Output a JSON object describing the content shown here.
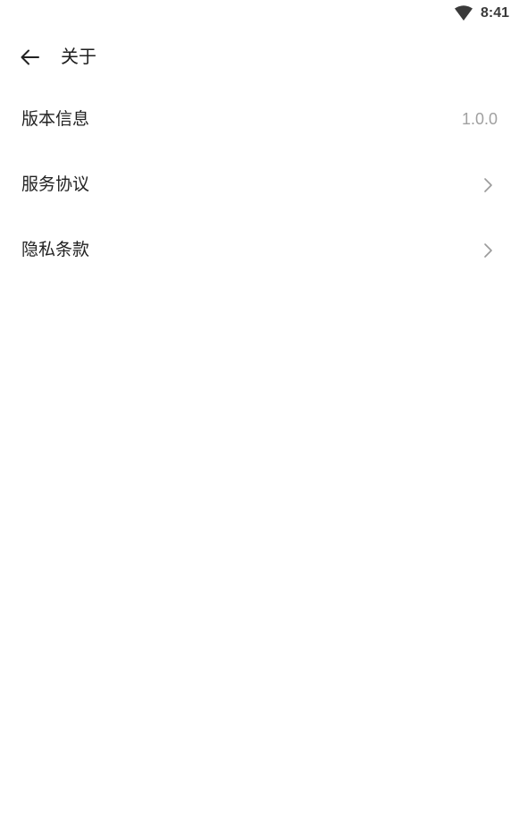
{
  "status_bar": {
    "time": "8:41",
    "wifi_icon": "wifi-icon"
  },
  "header": {
    "back_icon": "arrow-left-icon",
    "title": "关于"
  },
  "list": {
    "items": [
      {
        "label": "版本信息",
        "value": "1.0.0"
      },
      {
        "label": "服务协议",
        "icon": "chevron-right-icon"
      },
      {
        "label": "隐私条款",
        "icon": "chevron-right-icon"
      }
    ]
  },
  "colors": {
    "background": "#ffffff",
    "text_primary": "#222222",
    "text_secondary": "#a0a0a0",
    "chevron": "#9a9a9a"
  }
}
